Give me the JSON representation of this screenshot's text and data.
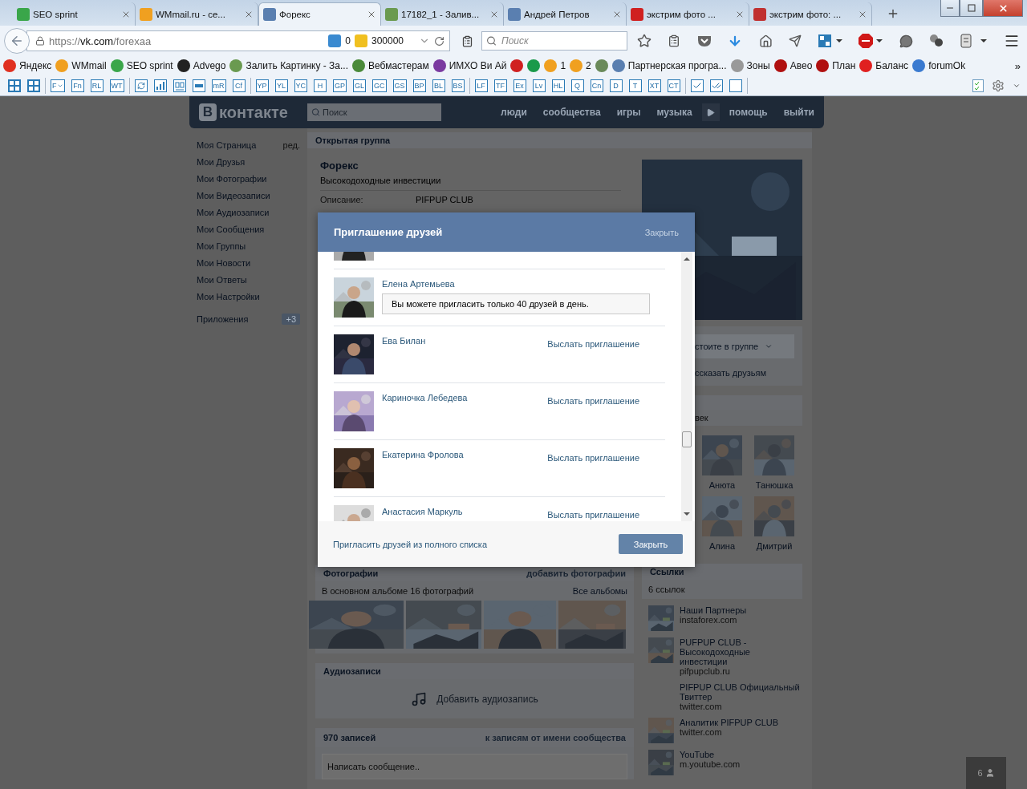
{
  "browser": {
    "tabs": [
      {
        "title": "SEO sprint",
        "selected": false
      },
      {
        "title": "WMmail.ru - се...",
        "selected": false
      },
      {
        "title": "Форекс",
        "selected": true
      },
      {
        "title": "17182_1 - Залив...",
        "selected": false
      },
      {
        "title": "Андрей Петров",
        "selected": false
      },
      {
        "title": "экстрим фото ...",
        "selected": false
      },
      {
        "title": "экстрим фото: ...",
        "selected": false
      }
    ],
    "address": {
      "scheme": "https://",
      "host": "vk.com",
      "path": "/forexaa"
    },
    "counters": [
      {
        "value": "0"
      },
      {
        "value": "300000"
      }
    ],
    "search_placeholder": "Поиск",
    "bookmarks": [
      {
        "kind": "link",
        "label": "Яндекс"
      },
      {
        "kind": "link",
        "label": "WMmail"
      },
      {
        "kind": "link",
        "label": "SEO sprint"
      },
      {
        "kind": "link",
        "label": "Advego"
      },
      {
        "kind": "link",
        "label": "Залить Картинку - За..."
      },
      {
        "kind": "link",
        "label": "Вебмастерам"
      },
      {
        "kind": "link",
        "label": "ИМХО Ви Ай"
      },
      {
        "kind": "icon"
      },
      {
        "kind": "icon"
      },
      {
        "kind": "link",
        "label": "1"
      },
      {
        "kind": "link",
        "label": "2"
      },
      {
        "kind": "icon"
      },
      {
        "kind": "link",
        "label": "Партнерская програ..."
      },
      {
        "kind": "link",
        "label": "Зоны"
      },
      {
        "kind": "link",
        "label": "Авео"
      },
      {
        "kind": "link",
        "label": "План"
      },
      {
        "kind": "link",
        "label": "Баланс"
      },
      {
        "kind": "link",
        "label": "forumOk"
      }
    ],
    "bookmarks_more": "»",
    "toolbar_groups": [
      [
        {
          "kind": "sape"
        },
        {
          "kind": "sape"
        }
      ],
      [
        {
          "kind": "text",
          "label": "F",
          "dropdown": true
        },
        {
          "kind": "text",
          "label": "Fn"
        },
        {
          "kind": "text",
          "label": "RL"
        },
        {
          "kind": "text",
          "label": "WT"
        }
      ],
      [
        {
          "kind": "refresh"
        },
        {
          "kind": "chart"
        },
        {
          "kind": "glasses"
        },
        {
          "kind": "bar"
        },
        {
          "kind": "text",
          "label": "mR"
        },
        {
          "kind": "text",
          "label": "Cf"
        }
      ],
      [
        {
          "kind": "text",
          "label": "YP"
        },
        {
          "kind": "text",
          "label": "YL"
        },
        {
          "kind": "text",
          "label": "YC"
        },
        {
          "kind": "text",
          "label": "H"
        },
        {
          "kind": "text",
          "label": "GP"
        },
        {
          "kind": "text",
          "label": "GL"
        },
        {
          "kind": "text",
          "label": "GC"
        },
        {
          "kind": "text",
          "label": "GS"
        },
        {
          "kind": "text",
          "label": "BP"
        },
        {
          "kind": "text",
          "label": "BL"
        },
        {
          "kind": "text",
          "label": "BS"
        }
      ],
      [
        {
          "kind": "text",
          "label": "LF"
        },
        {
          "kind": "text",
          "label": "TF"
        },
        {
          "kind": "text",
          "label": "Ex"
        },
        {
          "kind": "text",
          "label": "Lv"
        },
        {
          "kind": "text",
          "label": "HL"
        },
        {
          "kind": "text",
          "label": "Q"
        },
        {
          "kind": "text",
          "label": "Cn"
        },
        {
          "kind": "text",
          "label": "D"
        },
        {
          "kind": "text",
          "label": "T"
        },
        {
          "kind": "text",
          "label": "XT"
        },
        {
          "kind": "text",
          "label": "CT"
        }
      ],
      [
        {
          "kind": "check"
        },
        {
          "kind": "doublecheck"
        },
        {
          "kind": "box"
        }
      ]
    ]
  },
  "vk": {
    "logo": {
      "mark": "В",
      "text": "контакте"
    },
    "search_placeholder": "Поиск",
    "nav": [
      {
        "kind": "link",
        "label": "люди"
      },
      {
        "kind": "link",
        "label": "сообщества"
      },
      {
        "kind": "link",
        "label": "игры"
      },
      {
        "kind": "link",
        "label": "музыка"
      },
      {
        "kind": "more"
      },
      {
        "kind": "link",
        "label": "помощь"
      },
      {
        "kind": "link",
        "label": "выйти"
      }
    ],
    "menu": [
      {
        "label": "Моя Страница",
        "extra": "ред."
      },
      {
        "label": "Мои Друзья"
      },
      {
        "label": "Мои Фотографии"
      },
      {
        "label": "Мои Видеозаписи"
      },
      {
        "label": "Мои Аудиозаписи"
      },
      {
        "label": "Мои Сообщения"
      },
      {
        "label": "Мои Группы"
      },
      {
        "label": "Мои Новости"
      },
      {
        "label": "Мои Ответы"
      },
      {
        "label": "Мои Настройки"
      },
      {
        "label": "Приложения",
        "badge": "+3"
      }
    ],
    "group": {
      "type_label": "Открытая группа",
      "name": "Форекс",
      "status": "Высокодоходные инвестиции",
      "info": [
        {
          "label": "Описание:",
          "value": "PIFPUP CLUB"
        }
      ]
    },
    "side": {
      "membership": "стоите в группе",
      "tell": "ссказать друзьям",
      "members_count": "век",
      "members": [
        {
          "name": "Анюта"
        },
        {
          "name": "Танюшка"
        },
        {
          "name": "Алина"
        },
        {
          "name": "Дмитрий"
        }
      ]
    },
    "photos": {
      "title": "Фотографии",
      "action": "добавить фотографии",
      "summary": "В основном альбоме 16 фотографий",
      "all": "Все альбомы"
    },
    "audio": {
      "title": "Аудиозаписи",
      "add": "Добавить аудиозапись"
    },
    "wall": {
      "title": "970 записей",
      "action": "к записям от имени сообщества",
      "placeholder": "Написать сообщение.."
    },
    "links": {
      "title": "Ссылки",
      "count": "6 ссылок",
      "items": [
        {
          "kind": "thumb",
          "title": "Наши Партнеры",
          "url": "instaforex.com"
        },
        {
          "kind": "thumb",
          "title": "PUFPUP CLUB - Высокодоходные инвестиции",
          "url": "pifpupclub.ru"
        },
        {
          "kind": "plain",
          "title": "PIFPUP CLUB Официальный Твиттер",
          "url": "twitter.com"
        },
        {
          "kind": "thumb",
          "title": "Аналитик PIFPUP CLUB",
          "url": "twitter.com"
        },
        {
          "kind": "thumb",
          "title": "YouTube",
          "url": "m.youtube.com"
        }
      ]
    },
    "online_counter": "6"
  },
  "modal": {
    "title": "Приглашение друзей",
    "close": "Закрыть",
    "friends": [
      {
        "kind": "partial"
      },
      {
        "kind": "notice",
        "name": "Елена Артемьева",
        "notice": "Вы можете пригласить только 40 друзей в день."
      },
      {
        "kind": "invite",
        "name": "Ева Билан",
        "action": "Выслать приглашение"
      },
      {
        "kind": "invite",
        "name": "Кариночка Лебедева",
        "action": "Выслать приглашение"
      },
      {
        "kind": "invite",
        "name": "Екатерина Фролова",
        "action": "Выслать приглашение"
      },
      {
        "kind": "invite",
        "name": "Анастасия Маркуль",
        "action": "Выслать приглашение"
      }
    ],
    "footer_link": "Пригласить друзей из полного списка",
    "button": "Закрыть"
  }
}
